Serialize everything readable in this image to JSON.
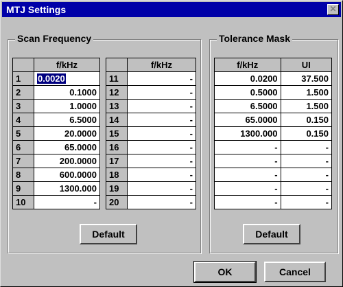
{
  "window": {
    "title": "MTJ Settings",
    "close_glyph": "✕"
  },
  "scan_frequency": {
    "title": "Scan Frequency",
    "header": "f/kHz",
    "left": [
      {
        "n": "1",
        "v": "0.0020",
        "selected": true
      },
      {
        "n": "2",
        "v": "0.1000"
      },
      {
        "n": "3",
        "v": "1.0000"
      },
      {
        "n": "4",
        "v": "6.5000"
      },
      {
        "n": "5",
        "v": "20.0000"
      },
      {
        "n": "6",
        "v": "65.0000"
      },
      {
        "n": "7",
        "v": "200.0000"
      },
      {
        "n": "8",
        "v": "600.0000"
      },
      {
        "n": "9",
        "v": "1300.000"
      },
      {
        "n": "10",
        "v": "-"
      }
    ],
    "right": [
      {
        "n": "11",
        "v": "-"
      },
      {
        "n": "12",
        "v": "-"
      },
      {
        "n": "13",
        "v": "-"
      },
      {
        "n": "14",
        "v": "-"
      },
      {
        "n": "15",
        "v": "-"
      },
      {
        "n": "16",
        "v": "-"
      },
      {
        "n": "17",
        "v": "-"
      },
      {
        "n": "18",
        "v": "-"
      },
      {
        "n": "19",
        "v": "-"
      },
      {
        "n": "20",
        "v": "-"
      }
    ],
    "default_label": "Default"
  },
  "tolerance_mask": {
    "title": "Tolerance Mask",
    "headers": [
      "f/kHz",
      "UI"
    ],
    "rows": [
      [
        "0.0200",
        "37.500"
      ],
      [
        "0.5000",
        "1.500"
      ],
      [
        "6.5000",
        "1.500"
      ],
      [
        "65.0000",
        "0.150"
      ],
      [
        "1300.000",
        "0.150"
      ],
      [
        "-",
        "-"
      ],
      [
        "-",
        "-"
      ],
      [
        "-",
        "-"
      ],
      [
        "-",
        "-"
      ],
      [
        "-",
        "-"
      ]
    ],
    "default_label": "Default"
  },
  "buttons": {
    "ok": "OK",
    "cancel": "Cancel"
  }
}
